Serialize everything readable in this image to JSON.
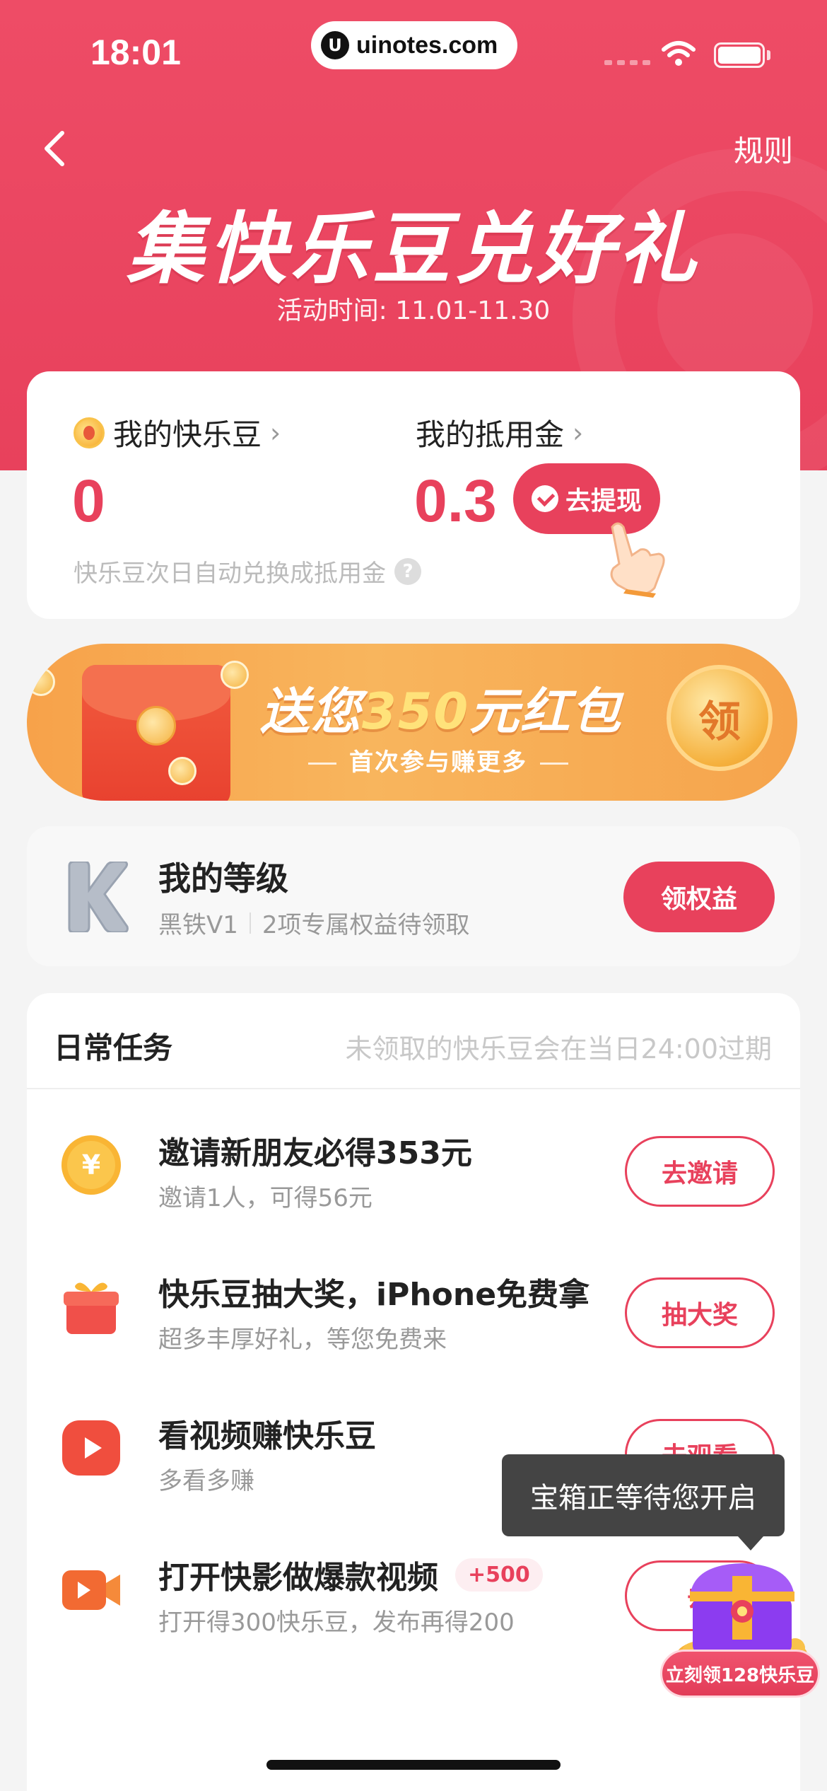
{
  "status_bar": {
    "time": "18:01",
    "url": "uinotes.com"
  },
  "header": {
    "rules_label": "规则",
    "title": "集快乐豆兑好礼",
    "activity_time": "活动时间: 11.01-11.30"
  },
  "balance": {
    "beans_label": "我的快乐豆",
    "beans_value": "0",
    "voucher_label": "我的抵用金",
    "voucher_value": "0.3",
    "withdraw_label": "去提现",
    "note": "快乐豆次日自动兑换成抵用金",
    "help_glyph": "?"
  },
  "banner": {
    "title_pre": "送您",
    "title_amount": "350",
    "title_post": "元红包",
    "subtitle": "首次参与赚更多",
    "claim_label": "领"
  },
  "level": {
    "title": "我的等级",
    "rank": "黑铁V1",
    "benefits": "2项专属权益待领取",
    "button_label": "领权益"
  },
  "tasks": {
    "title": "日常任务",
    "note": "未领取的快乐豆会在当日24:00过期",
    "items": [
      {
        "title": "邀请新朋友必得353元",
        "subtitle": "邀请1人，可得56元",
        "button": "去邀请",
        "icon": "yuan-coin-icon"
      },
      {
        "title": "快乐豆抽大奖，iPhone免费拿",
        "subtitle": "超多丰厚好礼，等您免费来",
        "button": "抽大奖",
        "icon": "gift-box-icon"
      },
      {
        "title": "看视频赚快乐豆",
        "subtitle": "多看多赚",
        "button": "去观看",
        "icon": "video-play-icon"
      },
      {
        "title": "打开快影做爆款视频",
        "subtitle": "打开得300快乐豆，发布再得200",
        "button": "去",
        "badge": "+500",
        "icon": "video-camera-icon"
      }
    ]
  },
  "floating": {
    "tooltip": "宝箱正等待您开启",
    "treasure_label": "立刻领128快乐豆"
  },
  "colors": {
    "brand": "#e8415c",
    "banner_orange": "#f7a24a"
  }
}
